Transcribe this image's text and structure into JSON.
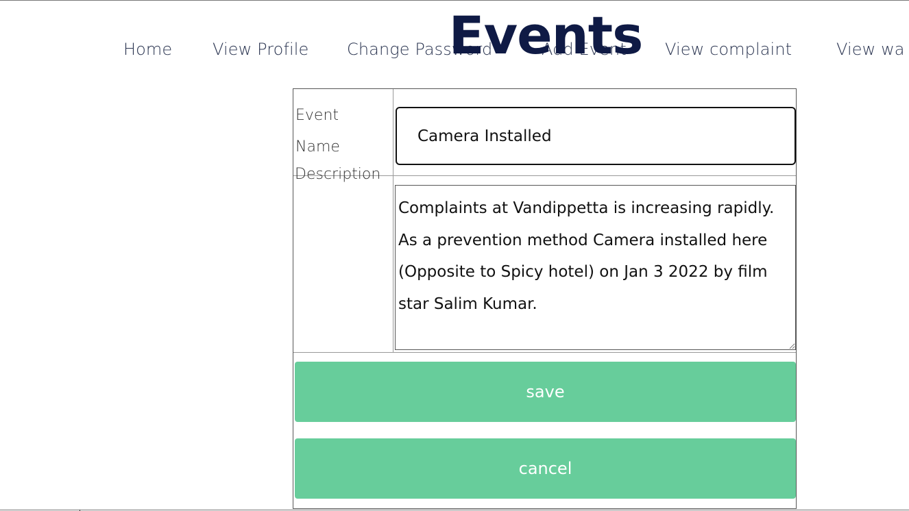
{
  "page": {
    "title": "Events"
  },
  "nav": {
    "items": [
      {
        "label": "Home"
      },
      {
        "label": "View Profile"
      },
      {
        "label": "Change Password"
      },
      {
        "label": "Add Event"
      },
      {
        "label": "View complaint"
      },
      {
        "label": "View wa"
      }
    ]
  },
  "form": {
    "event_name_label": "Event Name",
    "event_name_value": "Camera Installed",
    "description_label": "Description",
    "description_value": "Complaints at Vandippetta is increasing rapidly. As a prevention method Camera installed here (Opposite to Spicy hotel) on Jan 3 2022 by film star Salim Kumar.",
    "save_label": "save",
    "cancel_label": "cancel"
  },
  "colors": {
    "button_bg": "#67cd9b",
    "title": "#0f1a45",
    "nav_text": "#2a3450"
  }
}
